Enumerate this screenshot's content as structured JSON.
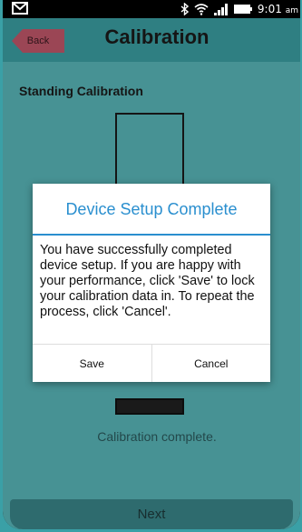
{
  "status_bar": {
    "time": "9:01",
    "ampm": "am",
    "icons": [
      "mail-icon",
      "bluetooth-icon",
      "wifi-icon",
      "signal-icon",
      "battery-icon"
    ]
  },
  "header": {
    "back_label": "Back",
    "title": "Calibration"
  },
  "main": {
    "section_title": "Standing Calibration",
    "status_text": "Calibration complete.",
    "next_label": "Next"
  },
  "dialog": {
    "title": "Device Setup Complete",
    "message": "You have successfully completed device setup. If you are happy with your performance, click 'Save' to lock your calibration data in. To repeat the process, click 'Cancel'.",
    "save_label": "Save",
    "cancel_label": "Cancel"
  },
  "colors": {
    "accent": "#2a8fcf",
    "header": "#3da3a7",
    "back_button": "#c75a6d",
    "background": "#5cbcbe"
  }
}
